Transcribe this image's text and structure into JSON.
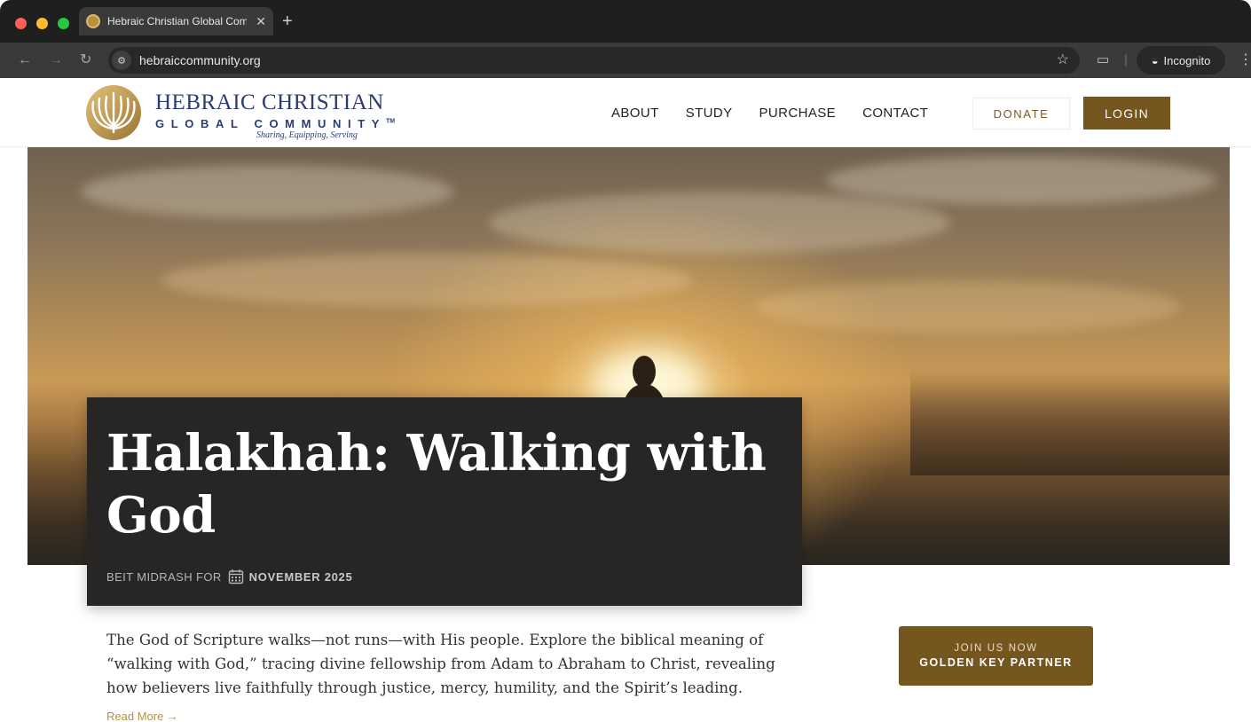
{
  "browser": {
    "tab_title": "Hebraic Christian Global Com",
    "tab_close": "✕",
    "new_tab": "+",
    "url": "hebraiccommunity.org",
    "incognito_label": "Incognito"
  },
  "site": {
    "logo": {
      "line1": "HEBRAIC CHRISTIAN",
      "line2": "GLOBAL COMMUNITY",
      "trademark": "TM",
      "tagline": "Sharing, Equipping, Serving"
    },
    "nav": [
      "ABOUT",
      "STUDY",
      "PURCHASE",
      "CONTACT"
    ],
    "donate_label": "DONATE",
    "login_label": "LOGIN"
  },
  "hero": {
    "title": "Halakhah: Walking with God",
    "meta_prefix": "BEIT MIDRASH FOR",
    "meta_date": "NOVEMBER 2025"
  },
  "article": {
    "excerpt": "The God of Scripture walks—not runs—with His people. Explore the biblical meaning of “walking with God,” tracing divine fellowship from Adam to Abraham to Christ, revealing how believers live faithfully through justice, mercy, humility, and the Spirit’s leading.",
    "read_more": "Read More →"
  },
  "cta": {
    "line1": "JOIN US NOW",
    "line2": "GOLDEN KEY PARTNER"
  },
  "colors": {
    "brand_gold": "#76561f",
    "brand_navy": "#2a3c72",
    "card_dark": "#272625"
  }
}
